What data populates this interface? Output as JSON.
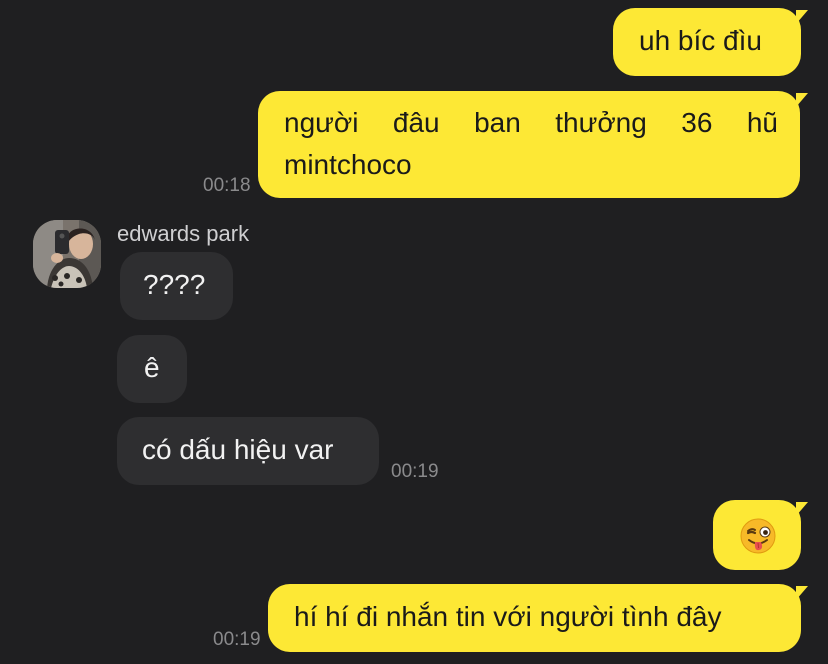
{
  "messages": {
    "m1": {
      "text": "uh bíc đìu"
    },
    "m2": {
      "text": "người đâu ban thưởng 36 hũ mintchoco",
      "time": "00:18"
    },
    "sender": {
      "name": "edwards park"
    },
    "m3": {
      "text": "????"
    },
    "m4": {
      "text": "ê"
    },
    "m5": {
      "text": "có dấu hiệu var",
      "time": "00:19"
    },
    "m6": {
      "emoji": "winking-face-with-tongue"
    },
    "m7": {
      "text": "hí hí đi nhắn tin với người tình đây",
      "time": "00:19"
    }
  },
  "colors": {
    "background": "#1f1f21",
    "outgoing_bubble": "#fde835",
    "incoming_bubble": "#2e2e30",
    "timestamp": "#8a8a8c"
  }
}
